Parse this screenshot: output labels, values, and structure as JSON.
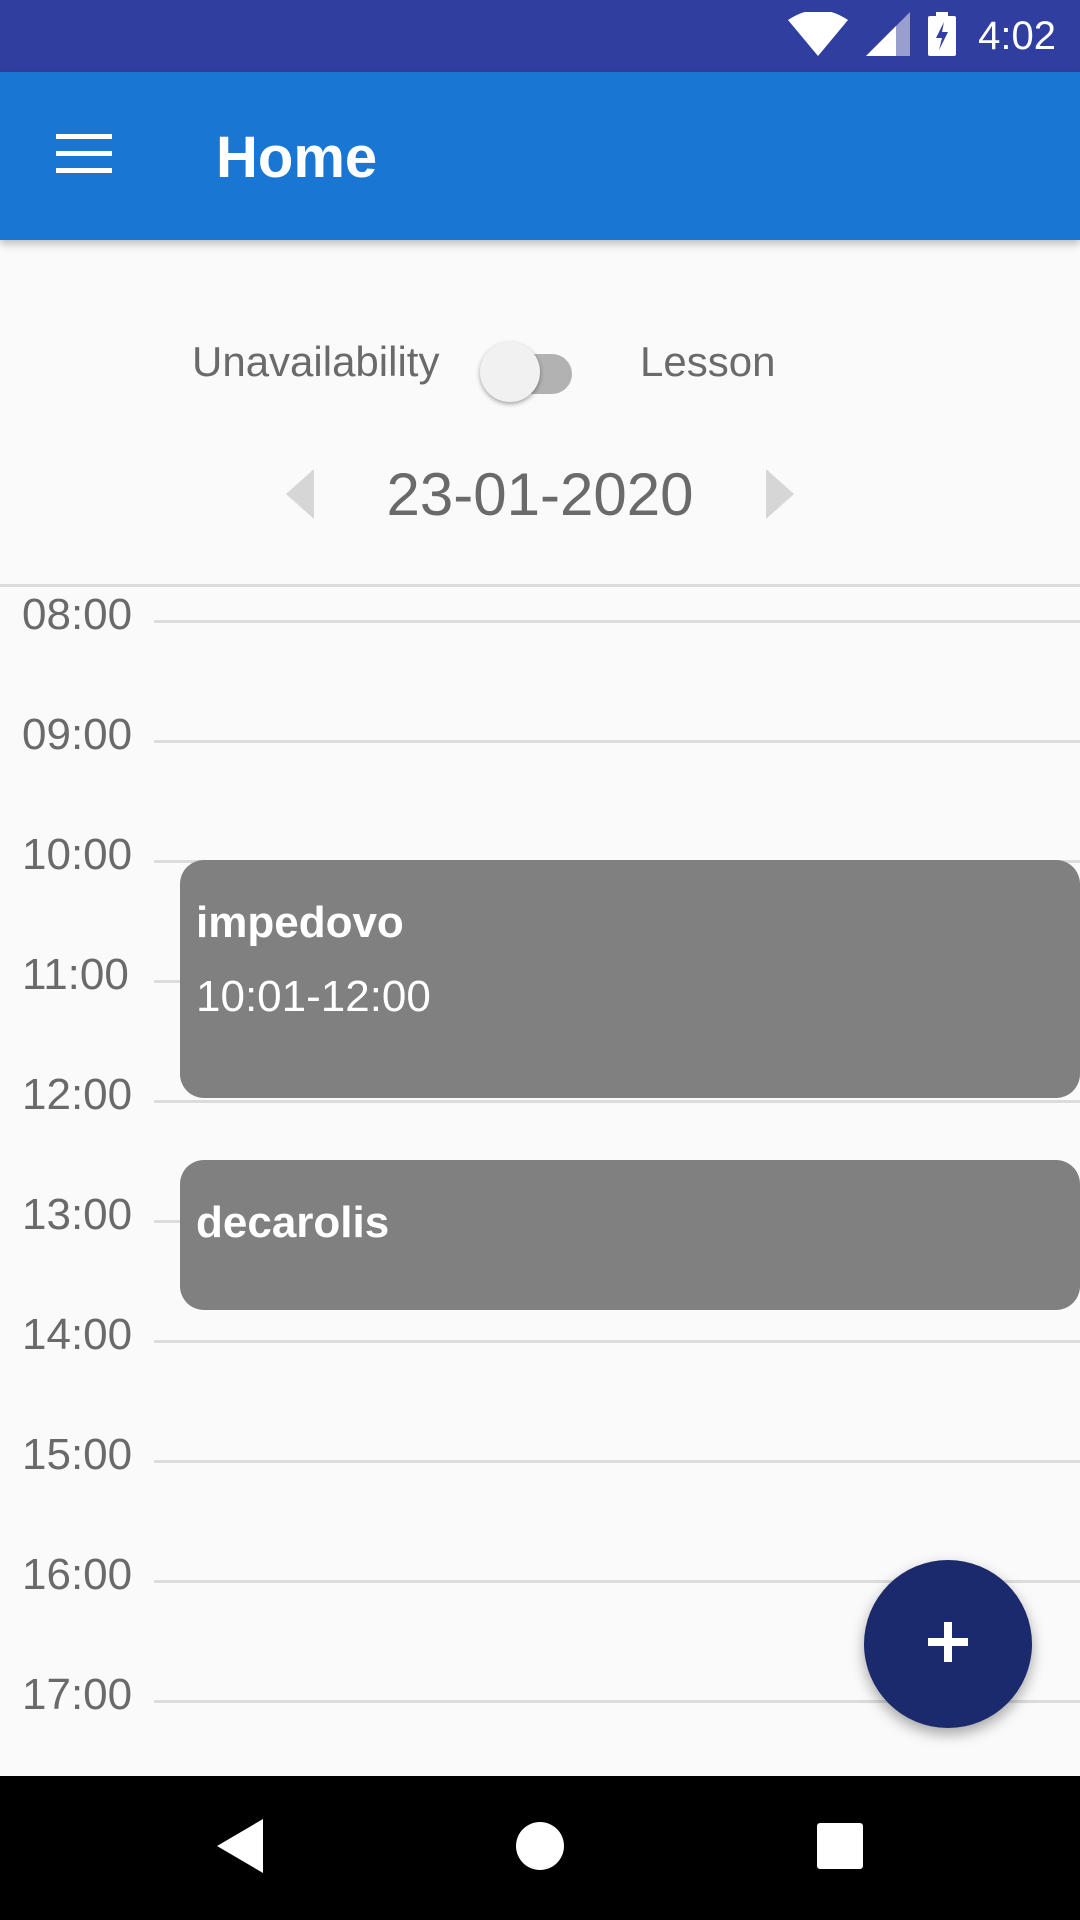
{
  "status_bar": {
    "time": "4:02",
    "icons": [
      "wifi-icon",
      "cell-signal-icon",
      "battery-charging-icon"
    ]
  },
  "app_bar": {
    "title": "Home",
    "menu_icon": "hamburger-menu-icon",
    "color": "#1976d2"
  },
  "mode_toggle": {
    "left_label": "Unavailability",
    "right_label": "Lesson",
    "state": "off"
  },
  "date_nav": {
    "date": "23-01-2020",
    "prev_icon": "chevron-left-icon",
    "next_icon": "chevron-right-icon"
  },
  "timeline": {
    "hours": [
      "08:00",
      "09:00",
      "10:00",
      "11:00",
      "12:00",
      "13:00",
      "14:00",
      "15:00",
      "16:00",
      "17:00"
    ],
    "events": [
      {
        "title": "impedovo",
        "time": "10:01-12:00",
        "start_hour": 10.0,
        "end_hour": 11.98
      },
      {
        "title": "decarolis",
        "time": "",
        "start_hour": 12.5,
        "end_hour": 13.75
      }
    ]
  },
  "fab": {
    "icon": "plus-icon",
    "color": "#1a2a6c"
  },
  "nav_bar": {
    "icons": [
      "back-icon",
      "home-icon",
      "recents-icon"
    ]
  }
}
